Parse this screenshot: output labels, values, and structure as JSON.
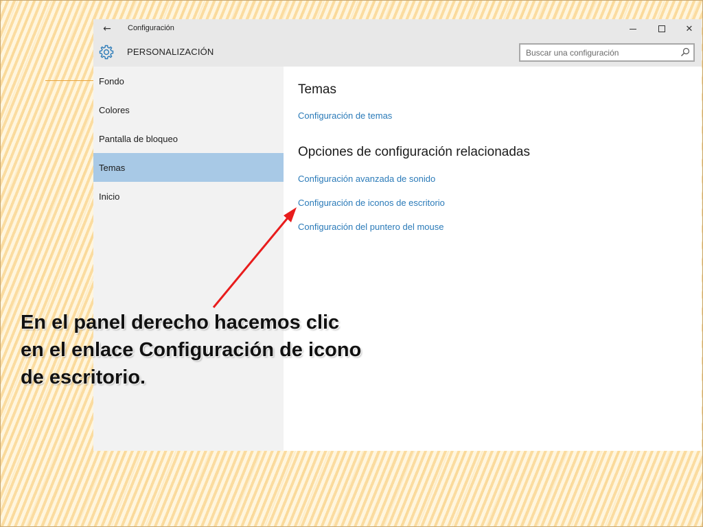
{
  "window": {
    "title": "Configuración",
    "back_icon": "arrow-left-icon",
    "controls": {
      "minimize_icon": "minimize-icon",
      "maximize_icon": "maximize-icon",
      "close_icon": "close-icon",
      "close_glyph": "✕",
      "back_glyph": "←"
    }
  },
  "header": {
    "icon": "gear-icon",
    "section_title": "PERSONALIZACIÓN",
    "search": {
      "placeholder": "Buscar una configuración",
      "value": "",
      "icon": "search-icon"
    }
  },
  "sidebar": {
    "items": [
      {
        "label": "Fondo",
        "selected": false
      },
      {
        "label": "Colores",
        "selected": false
      },
      {
        "label": "Pantalla de bloqueo",
        "selected": false
      },
      {
        "label": "Temas",
        "selected": true
      },
      {
        "label": "Inicio",
        "selected": false
      }
    ]
  },
  "main": {
    "themes_heading": "Temas",
    "themes_link": "Configuración de temas",
    "related_heading": "Opciones de configuración relacionadas",
    "related_links": [
      "Configuración avanzada de sonido",
      "Configuración de iconos de escritorio",
      "Configuración del puntero del mouse"
    ]
  },
  "annotation": {
    "caption_lines": [
      "En el panel derecho hacemos clic",
      "en el enlace Configuración de icono",
      "de escritorio."
    ],
    "arrow_color": "#e81c1c"
  },
  "colors": {
    "accent_selected": "#a8c9e6",
    "link": "#2a7ab8",
    "titlebar": "#e8e8e8",
    "sidebar_bg": "#f2f2f2"
  }
}
